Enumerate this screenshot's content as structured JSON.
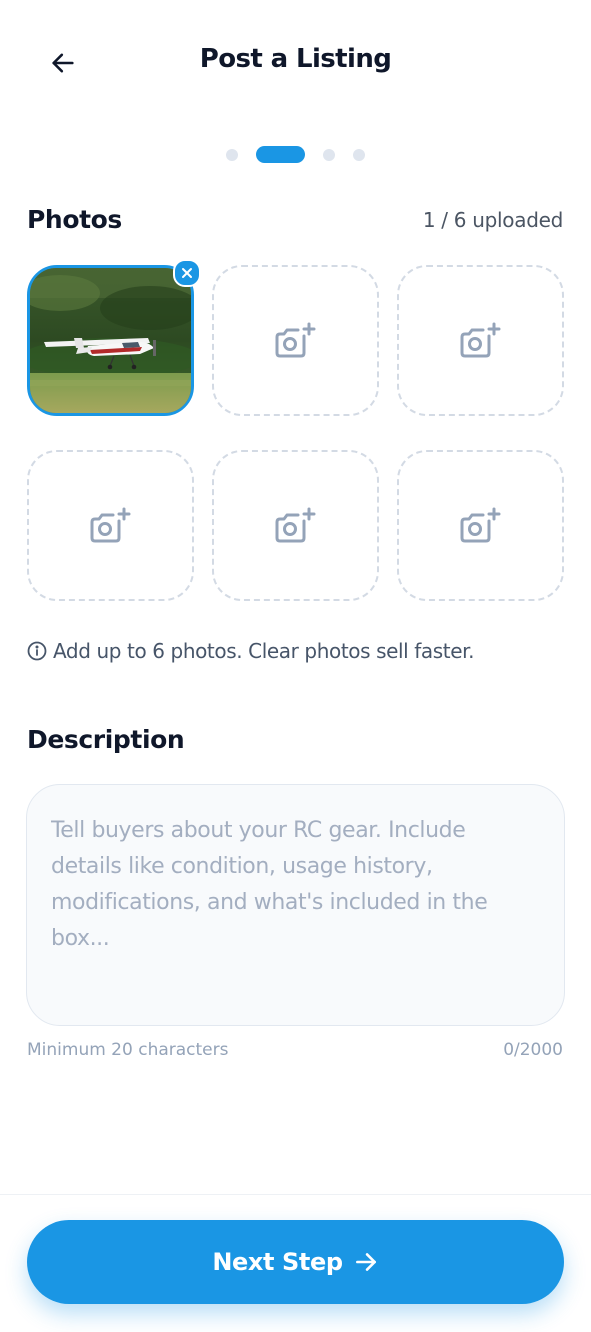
{
  "header": {
    "title": "Post a Listing",
    "back_icon": "arrow-left-icon"
  },
  "stepper": {
    "total_steps": 4,
    "current_step": 2
  },
  "photos": {
    "title": "Photos",
    "upload_count": "1 / 6 uploaded",
    "uploaded": 1,
    "max": 6,
    "slot_icon": "camera-plus-icon",
    "hint": "Add up to 6 photos. Clear photos sell faster."
  },
  "description": {
    "title": "Description",
    "value": "",
    "placeholder": "Tell buyers about your RC gear. Include details like condition, usage history, modifications, and what's included in the box...",
    "min_hint": "Minimum 20 characters",
    "counter": "0/2000"
  },
  "footer": {
    "next_label": "Next Step",
    "next_icon": "arrow-right-icon"
  },
  "colors": {
    "accent": "#1a96e4",
    "title": "#0f172a",
    "muted": "#94a3b8"
  }
}
